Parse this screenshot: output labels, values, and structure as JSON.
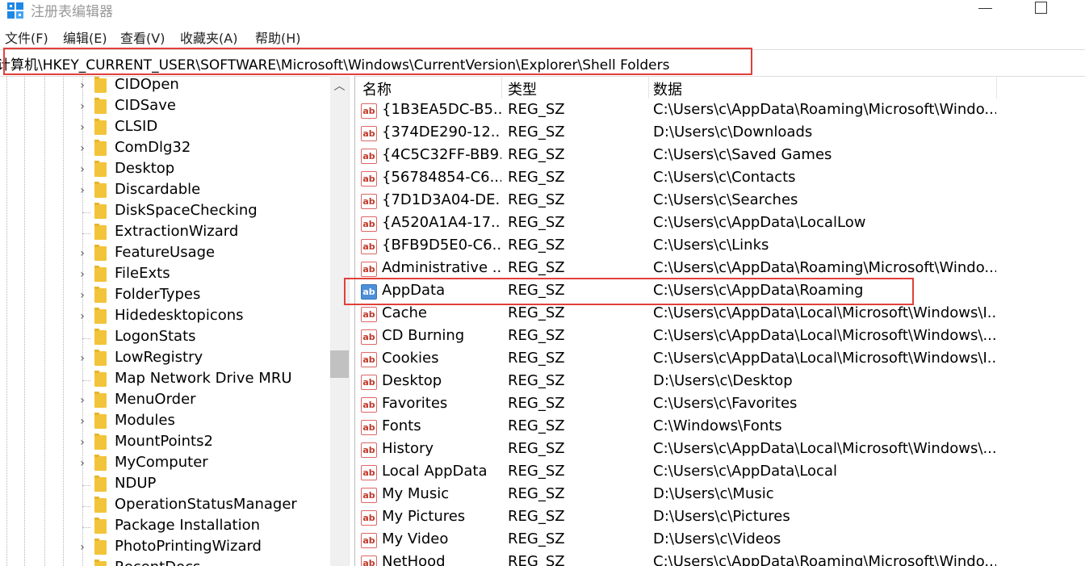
{
  "window": {
    "title": "注册表编辑器",
    "icon": "regedit-icon"
  },
  "menu": [
    "文件(F)",
    "编辑(E)",
    "查看(V)",
    "收藏夹(A)",
    "帮助(H)"
  ],
  "address": "计算机\\HKEY_CURRENT_USER\\SOFTWARE\\Microsoft\\Windows\\CurrentVersion\\Explorer\\Shell Folders",
  "tree": [
    {
      "label": "CIDOpen",
      "expandable": true
    },
    {
      "label": "CIDSave",
      "expandable": true
    },
    {
      "label": "CLSID",
      "expandable": true
    },
    {
      "label": "ComDlg32",
      "expandable": true
    },
    {
      "label": "Desktop",
      "expandable": true
    },
    {
      "label": "Discardable",
      "expandable": true
    },
    {
      "label": "DiskSpaceChecking",
      "expandable": false
    },
    {
      "label": "ExtractionWizard",
      "expandable": false
    },
    {
      "label": "FeatureUsage",
      "expandable": true
    },
    {
      "label": "FileExts",
      "expandable": true
    },
    {
      "label": "FolderTypes",
      "expandable": true
    },
    {
      "label": "Hidedesktopicons",
      "expandable": true
    },
    {
      "label": "LogonStats",
      "expandable": false
    },
    {
      "label": "LowRegistry",
      "expandable": true
    },
    {
      "label": "Map Network Drive MRU",
      "expandable": false
    },
    {
      "label": "MenuOrder",
      "expandable": true
    },
    {
      "label": "Modules",
      "expandable": true
    },
    {
      "label": "MountPoints2",
      "expandable": true
    },
    {
      "label": "MyComputer",
      "expandable": true
    },
    {
      "label": "NDUP",
      "expandable": false
    },
    {
      "label": "OperationStatusManager",
      "expandable": false
    },
    {
      "label": "Package Installation",
      "expandable": false
    },
    {
      "label": "PhotoPrintingWizard",
      "expandable": true
    },
    {
      "label": "RecentDocs",
      "expandable": true
    }
  ],
  "columns": {
    "name": "名称",
    "type": "类型",
    "data": "数据"
  },
  "values": [
    {
      "name": "{1B3EA5DC-B5...",
      "type": "REG_SZ",
      "data": "C:\\Users\\c\\AppData\\Roaming\\Microsoft\\Windo..."
    },
    {
      "name": "{374DE290-12...",
      "type": "REG_SZ",
      "data": "D:\\Users\\c\\Downloads"
    },
    {
      "name": "{4C5C32FF-BB9...",
      "type": "REG_SZ",
      "data": "C:\\Users\\c\\Saved Games"
    },
    {
      "name": "{56784854-C6...",
      "type": "REG_SZ",
      "data": "C:\\Users\\c\\Contacts"
    },
    {
      "name": "{7D1D3A04-DE...",
      "type": "REG_SZ",
      "data": "C:\\Users\\c\\Searches"
    },
    {
      "name": "{A520A1A4-17...",
      "type": "REG_SZ",
      "data": "C:\\Users\\c\\AppData\\LocalLow"
    },
    {
      "name": "{BFB9D5E0-C6...",
      "type": "REG_SZ",
      "data": "C:\\Users\\c\\Links"
    },
    {
      "name": "Administrative ...",
      "type": "REG_SZ",
      "data": "C:\\Users\\c\\AppData\\Roaming\\Microsoft\\Windo..."
    },
    {
      "name": "AppData",
      "type": "REG_SZ",
      "data": "C:\\Users\\c\\AppData\\Roaming",
      "selected": true
    },
    {
      "name": "Cache",
      "type": "REG_SZ",
      "data": "C:\\Users\\c\\AppData\\Local\\Microsoft\\Windows\\I..."
    },
    {
      "name": "CD Burning",
      "type": "REG_SZ",
      "data": "C:\\Users\\c\\AppData\\Local\\Microsoft\\Windows\\..."
    },
    {
      "name": "Cookies",
      "type": "REG_SZ",
      "data": "C:\\Users\\c\\AppData\\Local\\Microsoft\\Windows\\I..."
    },
    {
      "name": "Desktop",
      "type": "REG_SZ",
      "data": "D:\\Users\\c\\Desktop"
    },
    {
      "name": "Favorites",
      "type": "REG_SZ",
      "data": "C:\\Users\\c\\Favorites"
    },
    {
      "name": "Fonts",
      "type": "REG_SZ",
      "data": "C:\\Windows\\Fonts"
    },
    {
      "name": "History",
      "type": "REG_SZ",
      "data": "C:\\Users\\c\\AppData\\Local\\Microsoft\\Windows\\..."
    },
    {
      "name": "Local AppData",
      "type": "REG_SZ",
      "data": "C:\\Users\\c\\AppData\\Local"
    },
    {
      "name": "My Music",
      "type": "REG_SZ",
      "data": "D:\\Users\\c\\Music"
    },
    {
      "name": "My Pictures",
      "type": "REG_SZ",
      "data": "D:\\Users\\c\\Pictures"
    },
    {
      "name": "My Video",
      "type": "REG_SZ",
      "data": "D:\\Users\\c\\Videos"
    },
    {
      "name": "NetHood",
      "type": "REG_SZ",
      "data": "C:\\Users\\c\\AppData\\Roaming\\Microsoft\\Windo..."
    }
  ],
  "icons": {
    "value": "reg-string-icon",
    "folder": "folder-icon",
    "chevron": "chevron-right-icon"
  },
  "colors": {
    "highlight_border": "#e0403a",
    "folder": "#f2c43a",
    "selected_icon": "#4d8fd8"
  }
}
